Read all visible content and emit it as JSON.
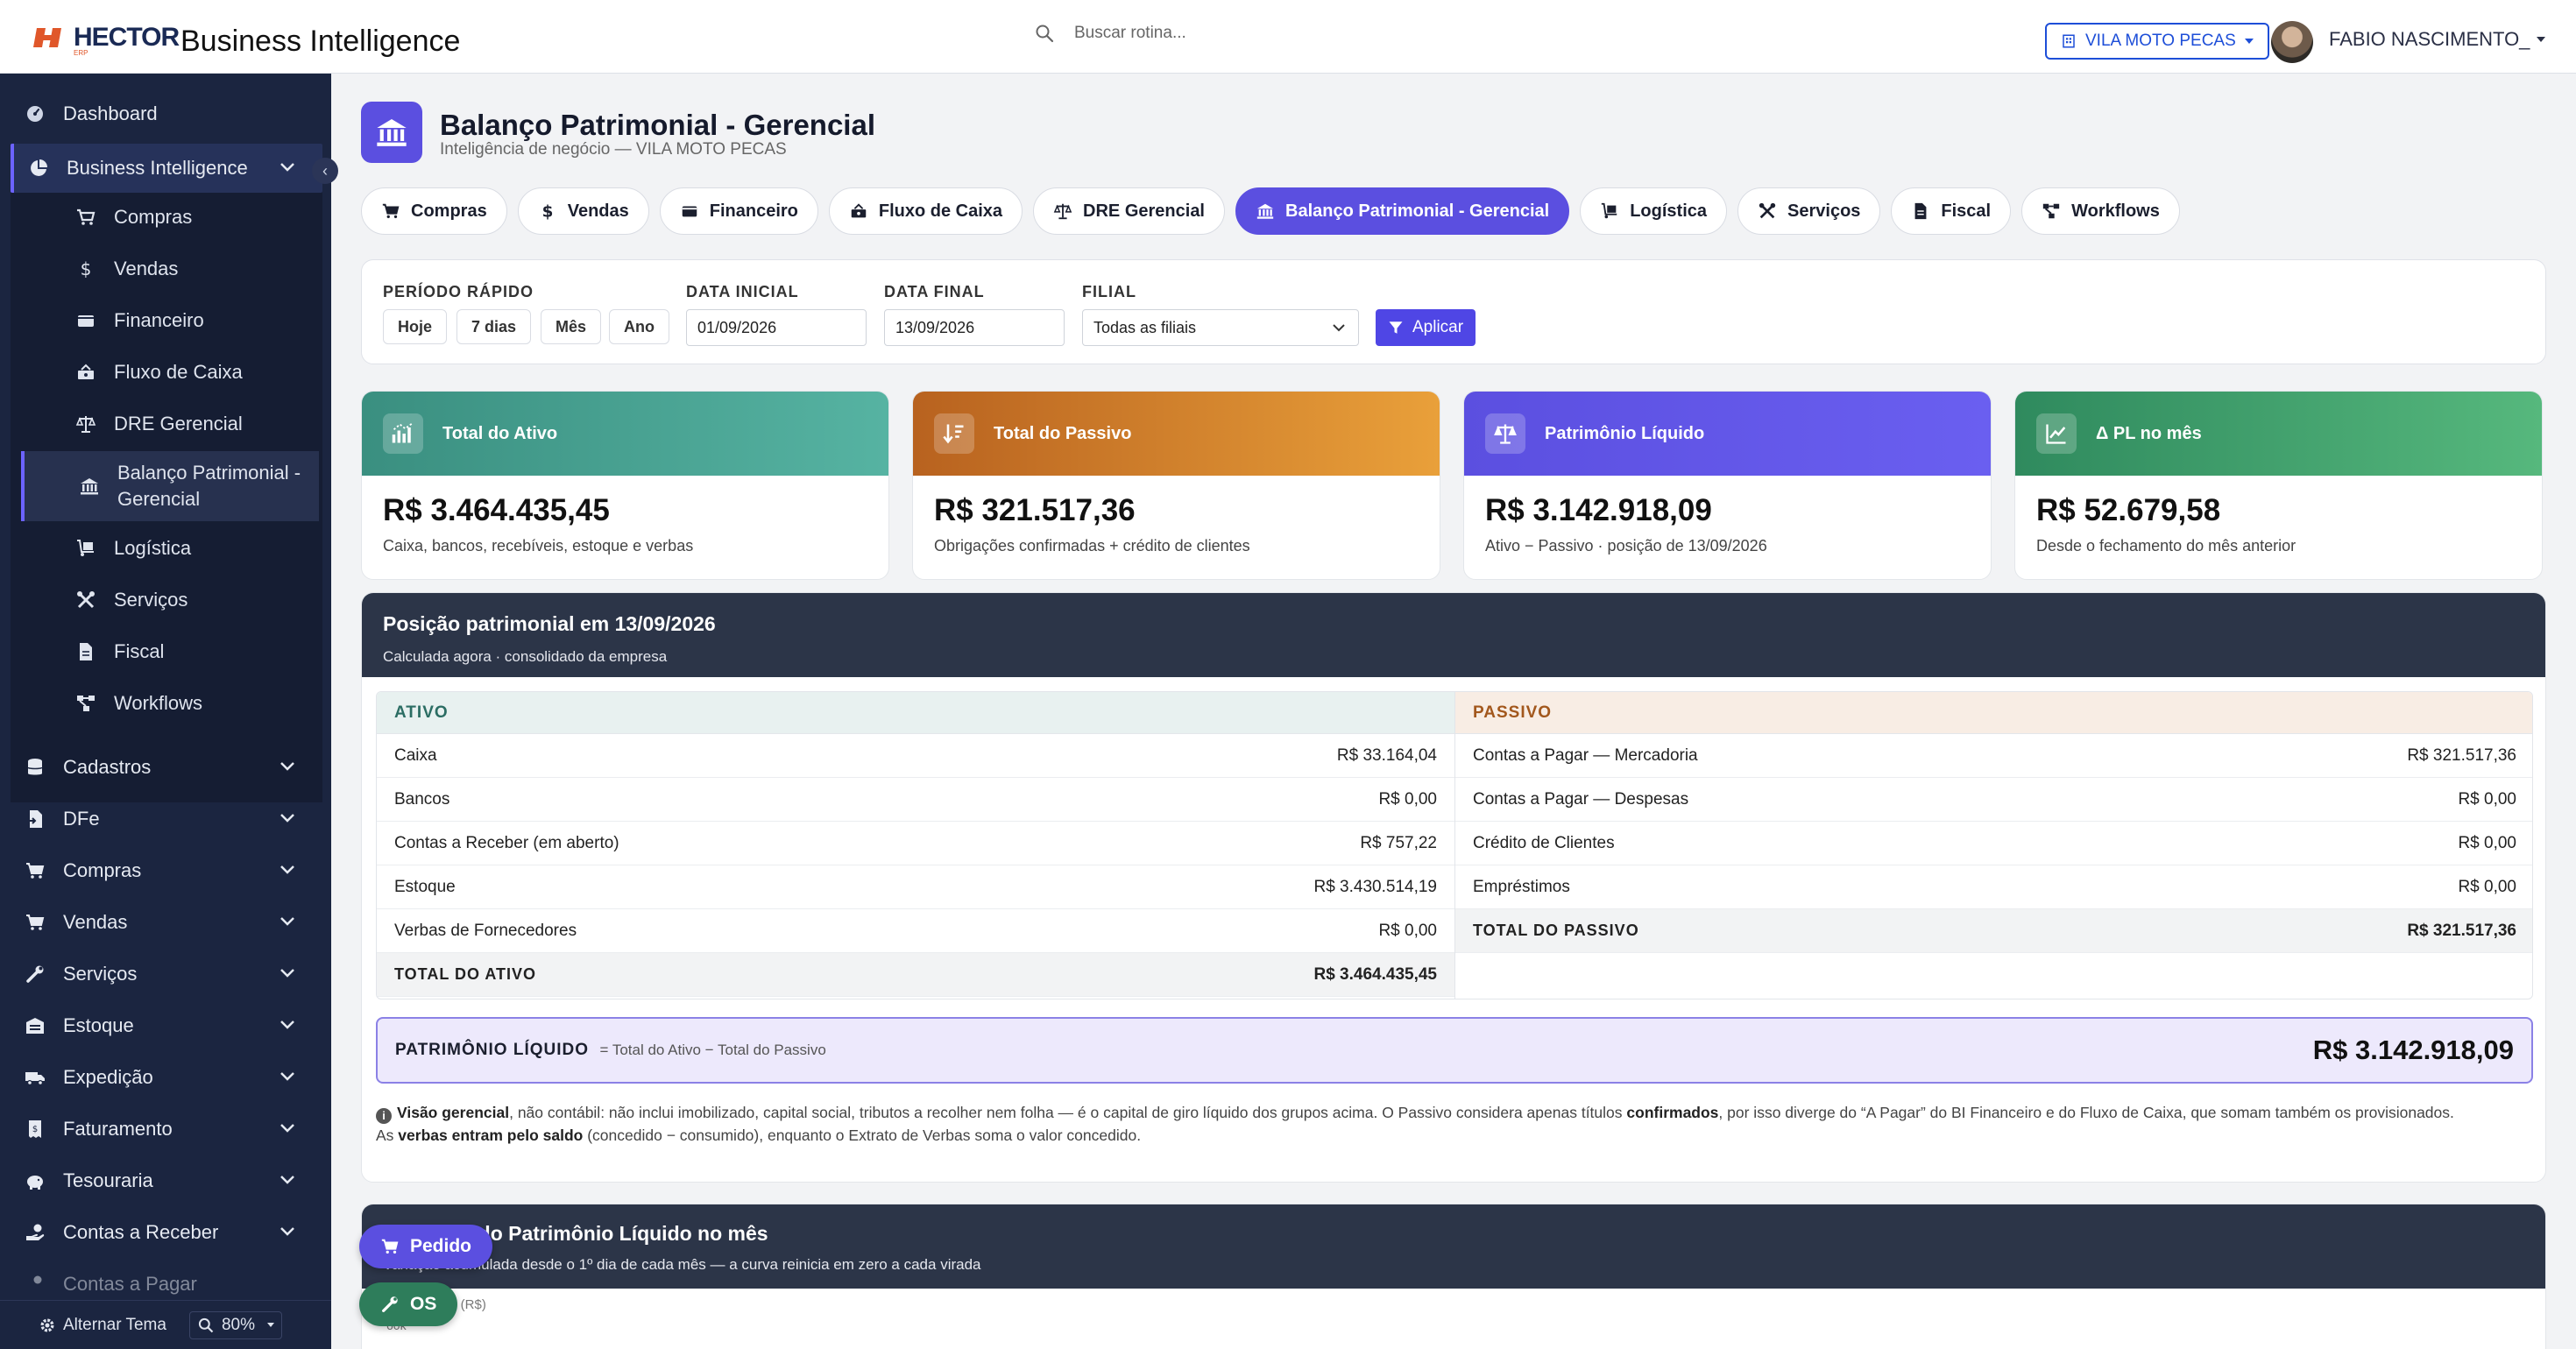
{
  "header": {
    "logo_text": "HECTOR",
    "logo_sub": "ERP",
    "app_title": "Business Intelligence",
    "search_placeholder": "Buscar rotina...",
    "branch_label": "VILA MOTO PECAS",
    "user_name": "FABIO NASCIMENTO_"
  },
  "sidebar": {
    "dashboard": "Dashboard",
    "bi_label": "Business Intelligence",
    "bi_items": [
      "Compras",
      "Vendas",
      "Financeiro",
      "Fluxo de Caixa",
      "DRE Gerencial",
      "Balanço Patrimonial - Gerencial",
      "Logística",
      "Serviços",
      "Fiscal",
      "Workflows"
    ],
    "groups": [
      "Cadastros",
      "DFe",
      "Compras",
      "Vendas",
      "Serviços",
      "Estoque",
      "Expedição",
      "Faturamento",
      "Tesouraria",
      "Contas a Receber",
      "Contas a Pagar"
    ],
    "theme_toggle": "Alternar Tema",
    "zoom": "80%"
  },
  "page": {
    "title": "Balanço Patrimonial - Gerencial",
    "subtitle": "Inteligência de negócio — VILA MOTO PECAS"
  },
  "tabs": [
    {
      "label": "Compras",
      "icon": "cart-icon"
    },
    {
      "label": "Vendas",
      "icon": "dollar-icon"
    },
    {
      "label": "Financeiro",
      "icon": "wallet-icon"
    },
    {
      "label": "Fluxo de Caixa",
      "icon": "cash-flow-icon"
    },
    {
      "label": "DRE Gerencial",
      "icon": "scale-icon"
    },
    {
      "label": "Balanço Patrimonial - Gerencial",
      "icon": "bank-icon",
      "active": true
    },
    {
      "label": "Logística",
      "icon": "dolly-icon"
    },
    {
      "label": "Serviços",
      "icon": "tools-icon"
    },
    {
      "label": "Fiscal",
      "icon": "document-icon"
    },
    {
      "label": "Workflows",
      "icon": "workflow-icon"
    }
  ],
  "filters": {
    "quick_period_label": "PERÍODO RÁPIDO",
    "quick_buttons": [
      "Hoje",
      "7 dias",
      "Mês",
      "Ano"
    ],
    "start_label": "DATA INICIAL",
    "start_value": "01/09/2026",
    "end_label": "DATA FINAL",
    "end_value": "13/09/2026",
    "branch_label": "FILIAL",
    "branch_value": "Todas as filiais",
    "apply_label": "Aplicar"
  },
  "kpis": [
    {
      "title": "Total do Ativo",
      "value": "R$ 3.464.435,45",
      "note": "Caixa, bancos, recebíveis, estoque e verbas",
      "color_start": "#3a8f80",
      "color_end": "#56b3a2"
    },
    {
      "title": "Total do Passivo",
      "value": "R$ 321.517,36",
      "note": "Obrigações confirmadas + crédito de clientes",
      "color_start": "#b8621f",
      "color_end": "#e9a03a"
    },
    {
      "title": "Patrimônio Líquido",
      "value": "R$ 3.142.918,09",
      "note": "Ativo − Passivo · posição de 13/09/2026",
      "color_start": "#5b4fe0",
      "color_end": "#6a5ff0"
    },
    {
      "title": "Δ PL no mês",
      "value": "R$ 52.679,58",
      "note": "Desde o fechamento do mês anterior",
      "color_start": "#2f8a5e",
      "color_end": "#56b87d"
    }
  ],
  "balance": {
    "title": "Posição patrimonial em 13/09/2026",
    "subtitle": "Calculada agora · consolidado da empresa",
    "ativo_header": "ATIVO",
    "passivo_header": "PASSIVO",
    "ativo_rows": [
      {
        "label": "Caixa",
        "value": "R$ 33.164,04"
      },
      {
        "label": "Bancos",
        "value": "R$ 0,00"
      },
      {
        "label": "Contas a Receber (em aberto)",
        "value": "R$ 757,22"
      },
      {
        "label": "Estoque",
        "value": "R$ 3.430.514,19"
      },
      {
        "label": "Verbas de Fornecedores",
        "value": "R$ 0,00"
      }
    ],
    "ativo_total": {
      "label": "TOTAL DO ATIVO",
      "value": "R$ 3.464.435,45"
    },
    "passivo_rows": [
      {
        "label": "Contas a Pagar — Mercadoria",
        "value": "R$ 321.517,36"
      },
      {
        "label": "Contas a Pagar — Despesas",
        "value": "R$ 0,00"
      },
      {
        "label": "Crédito de Clientes",
        "value": "R$ 0,00"
      },
      {
        "label": "Empréstimos",
        "value": "R$ 0,00"
      }
    ],
    "passivo_total": {
      "label": "TOTAL DO PASSIVO",
      "value": "R$ 321.517,36"
    },
    "pl_label": "PATRIMÔNIO LÍQUIDO",
    "pl_formula": "= Total do Ativo − Total do Passivo",
    "pl_value": "R$ 3.142.918,09",
    "note_parts": {
      "a": "Visão gerencial",
      "b": ", não contábil: não inclui imobilizado, capital social, tributos a recolher nem folha — é o capital de giro líquido dos grupos acima. O Passivo considera apenas títulos ",
      "c": "confirmados",
      "d": ", por isso diverge do “A Pagar” do BI Financeiro e do Fluxo de Caixa, que somam também os provisionados.",
      "e": "As ",
      "f": "verbas entram pelo saldo",
      "g": " (concedido − consumido), enquanto o Extrato de Verbas soma o valor concedido."
    }
  },
  "trend": {
    "title": "Evolução do Patrimônio Líquido no mês",
    "subtitle": "Variação acumulada desde o 1º dia de cada mês — a curva reinicia em zero a cada virada",
    "y_label": "Δ PL no mês (R$)",
    "first_tick": "60k"
  },
  "fabs": {
    "pedido": "Pedido",
    "os": "OS"
  }
}
